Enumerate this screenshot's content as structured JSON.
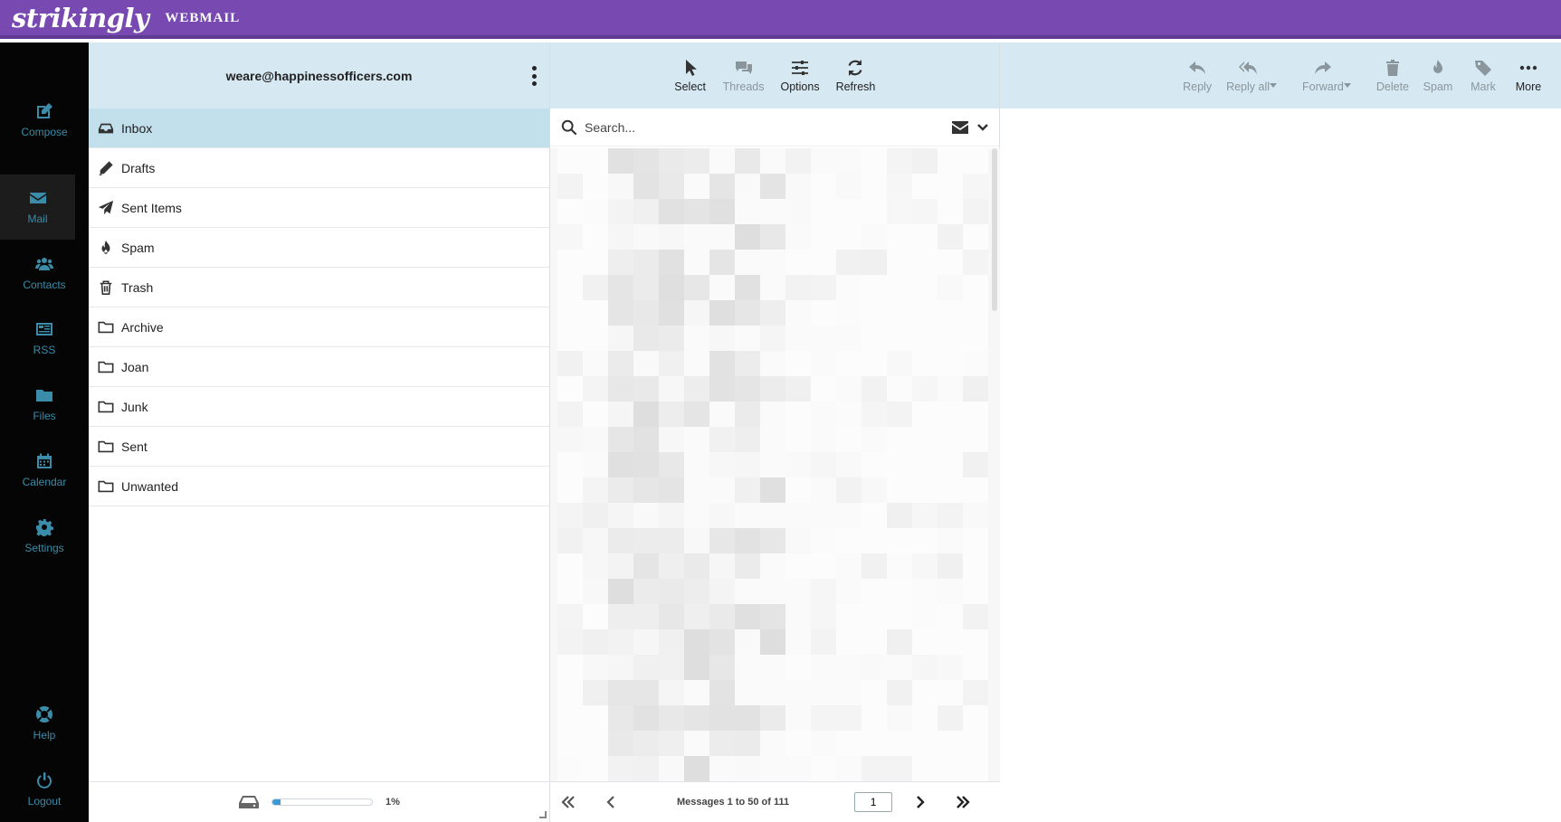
{
  "brand": {
    "logo_text": "strikingly",
    "product": "WEBMAIL"
  },
  "nav": {
    "items": [
      {
        "label": "Compose",
        "icon": "compose-icon"
      },
      {
        "label": "Mail",
        "icon": "envelope-icon",
        "active": true
      },
      {
        "label": "Contacts",
        "icon": "contacts-icon"
      },
      {
        "label": "RSS",
        "icon": "rss-icon"
      },
      {
        "label": "Files",
        "icon": "folder-icon"
      },
      {
        "label": "Calendar",
        "icon": "calendar-icon"
      },
      {
        "label": "Settings",
        "icon": "gear-icon"
      }
    ],
    "bottom": [
      {
        "label": "Help",
        "icon": "lifebuoy-icon"
      },
      {
        "label": "Logout",
        "icon": "power-icon"
      }
    ],
    "accent_color": "#3a8ca9"
  },
  "account": {
    "email": "weare@happinessofficers.com"
  },
  "folders": [
    {
      "label": "Inbox",
      "icon": "inbox-icon",
      "selected": true
    },
    {
      "label": "Drafts",
      "icon": "pencil-icon"
    },
    {
      "label": "Sent Items",
      "icon": "paper-plane-icon"
    },
    {
      "label": "Spam",
      "icon": "fire-icon"
    },
    {
      "label": "Trash",
      "icon": "trash-icon"
    },
    {
      "label": "Archive",
      "icon": "folder-icon"
    },
    {
      "label": "Joan",
      "icon": "folder-icon"
    },
    {
      "label": "Junk",
      "icon": "folder-icon"
    },
    {
      "label": "Sent",
      "icon": "folder-icon"
    },
    {
      "label": "Unwanted",
      "icon": "folder-icon"
    }
  ],
  "quota": {
    "percent_text": "1%",
    "fill_fraction": 0.01
  },
  "list_toolbar": {
    "select": "Select",
    "threads": "Threads",
    "options": "Options",
    "refresh": "Refresh"
  },
  "search": {
    "placeholder": "Search..."
  },
  "pager": {
    "count_text": "Messages 1 to 50 of 111",
    "page": "1"
  },
  "reader_toolbar": {
    "reply": "Reply",
    "reply_all": "Reply all",
    "forward": "Forward",
    "delete": "Delete",
    "spam": "Spam",
    "mark": "Mark",
    "more": "More"
  },
  "colors": {
    "topbar": "#7749b1",
    "panel_header": "#d6e8f2",
    "selected_folder": "#c2dfec"
  }
}
